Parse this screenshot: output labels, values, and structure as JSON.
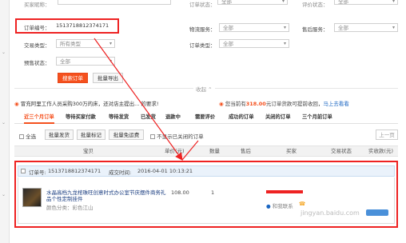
{
  "filters": {
    "top_cut_label": "买家昵称：",
    "order_status_label": "订单状态：",
    "order_status_value": "全部",
    "eval_status_label": "评价状态：",
    "eval_status_value": "全部",
    "order_no_label": "订单编号：",
    "order_no_value": "1513718812374171",
    "logistics_label": "物流服务：",
    "logistics_value": "全部",
    "aftersale_label": "售后服务：",
    "aftersale_value": "全部",
    "trade_type_label": "交易类型：",
    "trade_type_value": "所有类型",
    "order_type_label": "订单类型：",
    "order_type_value": "全部",
    "presale_label": "预售状态：",
    "presale_value": "全部",
    "search_button": "搜索订单",
    "export_button": "批量导出",
    "collapse_label": "收起"
  },
  "notices": {
    "left": "冒充阿里工作人员采购300万的床，还对店主提出... 的要求!",
    "right_prefix": "您当前有",
    "right_amount": "318.00",
    "right_suffix": "元订单货款可提前收回，",
    "right_link": "马上去看看"
  },
  "tabs": [
    {
      "label": "近三个月订单",
      "active": true
    },
    {
      "label": "等待买家付款",
      "active": false
    },
    {
      "label": "等待发货",
      "active": false
    },
    {
      "label": "已发货",
      "active": false
    },
    {
      "label": "退款中",
      "active": false
    },
    {
      "label": "需要评价",
      "active": false
    },
    {
      "label": "成功的订单",
      "active": false
    },
    {
      "label": "关闭的订单",
      "active": false
    },
    {
      "label": "三个月前订单",
      "active": false
    }
  ],
  "batch": {
    "select_all": "全选",
    "ship": "批量发货",
    "mark": "批量标记",
    "free_shipping": "批量免运费",
    "hide_closed": "不显示已关闭的订单",
    "prev_page": "上一页"
  },
  "table_header": {
    "item": "宝贝",
    "unit_price": "单价(元)",
    "quantity": "数量",
    "after_sale": "售后",
    "buyer": "买家",
    "trade_status": "交易状态",
    "amount": "实收款(元)"
  },
  "order": {
    "number_label": "订单号:",
    "number": "1513718812374171",
    "time_label": "成交时间:",
    "time": "2016-04-01 10:13:21",
    "item_title": "水晶高档九龙棺珠旺创意时式办公室节庆摆件商务礼品个性定制挂件",
    "item_spec": "颜色分类：彩色江山",
    "price": "108.00",
    "qty": "1",
    "contact_label": "和我联系"
  },
  "watermark": "jingyan.baidu.com",
  "colors": {
    "accent": "#f5511e",
    "highlight_box": "#e22222"
  }
}
